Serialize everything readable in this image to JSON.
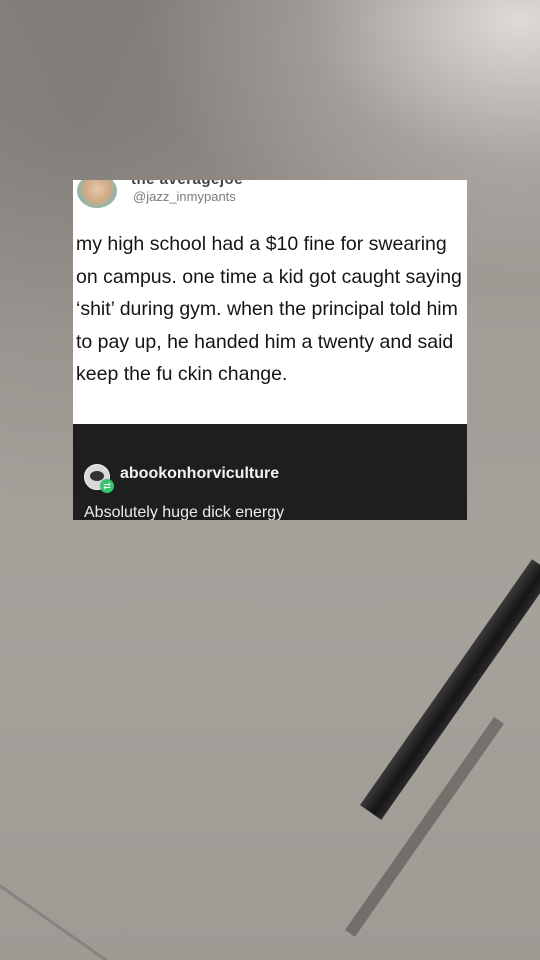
{
  "post": {
    "cropped_display_name": "the averagejoe",
    "handle": "@jazz_inmypants",
    "body": "my high school had a $10 fine for swearing on campus. one time a kid got caught saying ‘shit’ during gym. when the principal told him to pay up, he handed him a twenty and said keep the fu ckin change.",
    "avatar_icon": "user-avatar-icon"
  },
  "reblog": {
    "username": "abookonhorviculture",
    "comment": "Absolutely huge dick energy",
    "avatar_icon": "reblogger-avatar-icon",
    "badge_icon": "reblog-badge-icon",
    "badge_color": "#35c46b"
  }
}
